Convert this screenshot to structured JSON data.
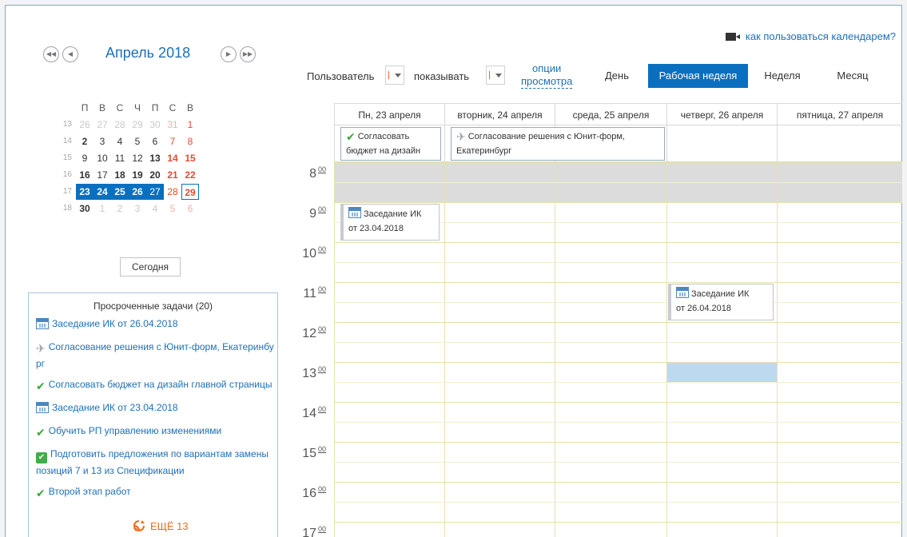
{
  "mini_calendar": {
    "title": "Апрель 2018",
    "weekday_headers": [
      "П",
      "В",
      "С",
      "Ч",
      "П",
      "С",
      "В"
    ],
    "weeks": [
      {
        "num": "13",
        "days": [
          {
            "d": "26",
            "t": "out"
          },
          {
            "d": "27",
            "t": "out"
          },
          {
            "d": "28",
            "t": "out"
          },
          {
            "d": "29",
            "t": "out"
          },
          {
            "d": "30",
            "t": "out"
          },
          {
            "d": "31",
            "t": "out we"
          },
          {
            "d": "1",
            "t": "we"
          }
        ]
      },
      {
        "num": "14",
        "days": [
          {
            "d": "2",
            "t": "bold"
          },
          {
            "d": "3",
            "t": ""
          },
          {
            "d": "4",
            "t": ""
          },
          {
            "d": "5",
            "t": ""
          },
          {
            "d": "6",
            "t": ""
          },
          {
            "d": "7",
            "t": "we"
          },
          {
            "d": "8",
            "t": "we"
          }
        ]
      },
      {
        "num": "15",
        "days": [
          {
            "d": "9",
            "t": ""
          },
          {
            "d": "10",
            "t": ""
          },
          {
            "d": "11",
            "t": ""
          },
          {
            "d": "12",
            "t": ""
          },
          {
            "d": "13",
            "t": "bold"
          },
          {
            "d": "14",
            "t": "we bold"
          },
          {
            "d": "15",
            "t": "we bold"
          }
        ]
      },
      {
        "num": "16",
        "days": [
          {
            "d": "16",
            "t": "bold"
          },
          {
            "d": "17",
            "t": ""
          },
          {
            "d": "18",
            "t": "bold"
          },
          {
            "d": "19",
            "t": "bold"
          },
          {
            "d": "20",
            "t": "bold"
          },
          {
            "d": "21",
            "t": "we bold"
          },
          {
            "d": "22",
            "t": "we bold"
          }
        ]
      },
      {
        "num": "17",
        "days": [
          {
            "d": "23",
            "t": "sel"
          },
          {
            "d": "24",
            "t": "sel"
          },
          {
            "d": "25",
            "t": "sel"
          },
          {
            "d": "26",
            "t": "sel"
          },
          {
            "d": "27",
            "t": "sel lt"
          },
          {
            "d": "28",
            "t": "we"
          },
          {
            "d": "29",
            "t": "today"
          }
        ]
      },
      {
        "num": "18",
        "days": [
          {
            "d": "30",
            "t": "bold"
          },
          {
            "d": "1",
            "t": "out"
          },
          {
            "d": "2",
            "t": "out"
          },
          {
            "d": "3",
            "t": "out"
          },
          {
            "d": "4",
            "t": "out"
          },
          {
            "d": "5",
            "t": "out we"
          },
          {
            "d": "6",
            "t": "out we"
          }
        ]
      }
    ],
    "today_button": "Сегодня"
  },
  "overdue": {
    "title": "Просроченные задачи (20)",
    "items": [
      {
        "icon": "calendar-icon",
        "text": "Заседание ИК от 26.04.2018"
      },
      {
        "icon": "plane-icon",
        "text": "Согласование решения с Юнит-форм, Екатеринбург"
      },
      {
        "icon": "check-icon",
        "text": "Согласовать бюджет на дизайн главной страницы"
      },
      {
        "icon": "calendar-icon",
        "text": "Заседание ИК от 23.04.2018"
      },
      {
        "icon": "check-icon",
        "text": "Обучить РП управлению изменениями"
      },
      {
        "icon": "checkbox-icon",
        "text": "Подготовить предложения по вариантам замены позиций 7 и 13 из Спецификации"
      },
      {
        "icon": "check-icon",
        "text": "Второй этап работ"
      }
    ],
    "more": "ЕЩЁ 13"
  },
  "header": {
    "howto_link": "как пользоваться календарем?",
    "user_label": "Пользователь",
    "show_label": "показывать",
    "options_line1": "опции",
    "options_line2": "просмотра",
    "views": [
      "День",
      "Рабочая неделя",
      "Неделя",
      "Месяц"
    ],
    "active_view": "Рабочая неделя"
  },
  "grid": {
    "columns": [
      "Пн, 23 апреля",
      "вторник, 24 апреля",
      "среда, 25 апреля",
      "четверг, 26 апреля",
      "пятница, 27 апреля"
    ],
    "hours": [
      "8",
      "9",
      "10",
      "11",
      "12",
      "13",
      "14",
      "15",
      "16",
      "17"
    ],
    "minutes": "00",
    "all_day_events": [
      {
        "icon": "check-icon",
        "line1": "Согласовать",
        "line2": "бюджет на дизайн"
      },
      {
        "icon": "plane-icon",
        "line1": "Согласование решения с Юнит-форм,",
        "line2": "Екатеринбург"
      }
    ],
    "timed_events": [
      {
        "icon": "calendar-icon",
        "line1": "Заседание ИК",
        "line2": "от 23.04.2018"
      },
      {
        "icon": "calendar-icon",
        "line1": "Заседание ИК",
        "line2": "от 26.04.2018"
      }
    ]
  }
}
